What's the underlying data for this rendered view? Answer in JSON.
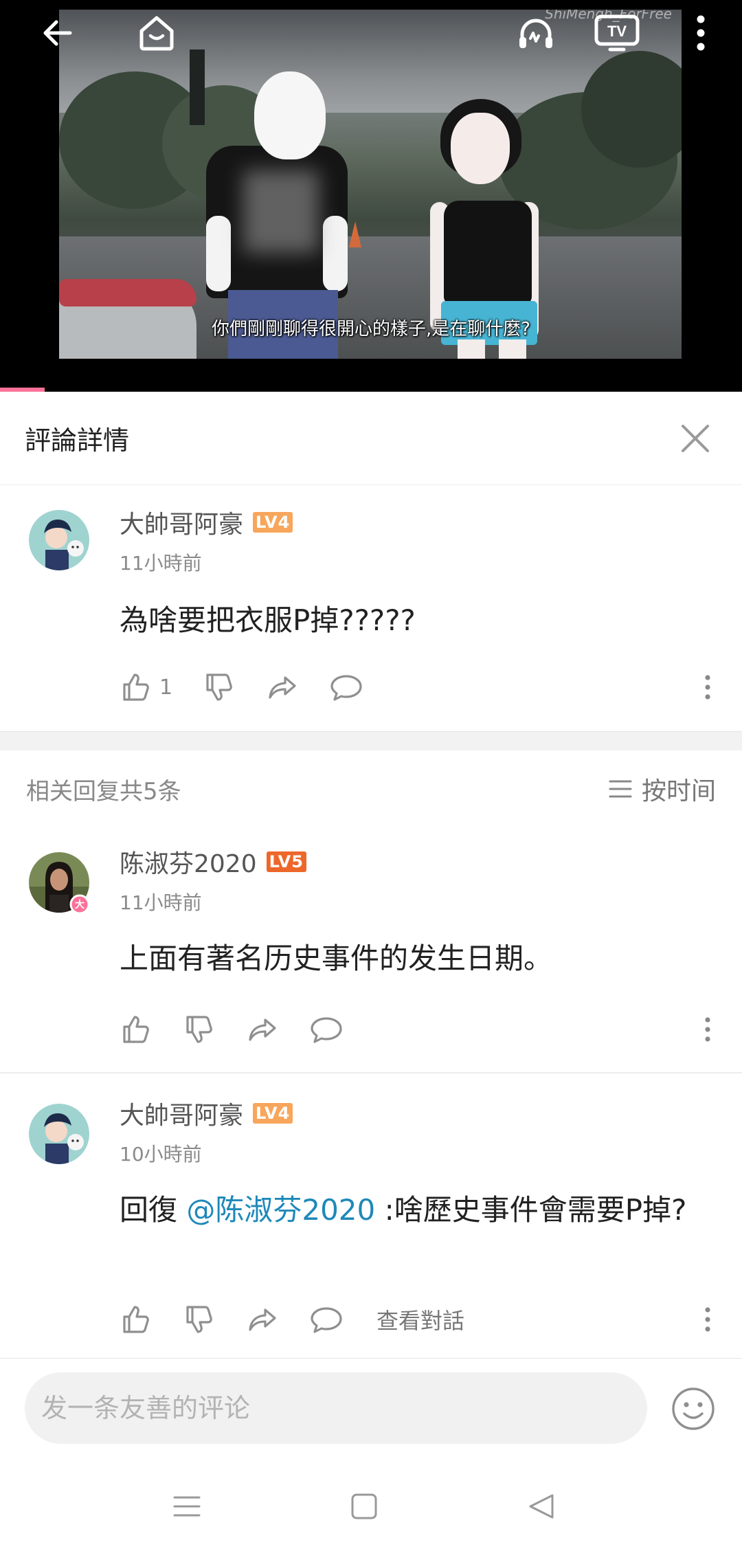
{
  "video": {
    "subtitle": "你們剛剛聊得很開心的樣子,是在聊什麼?",
    "watermark": "ShiMengh_ForFree",
    "progress_fraction": 0.06,
    "accent_color": "#fb7299",
    "icons": [
      "back-arrow-icon",
      "home-icon",
      "audio-mode-icon",
      "tv-cast-icon",
      "more-vertical-icon"
    ]
  },
  "panel": {
    "title": "評論詳情",
    "close_icon": "close-icon"
  },
  "main_comment": {
    "username": "大帥哥阿豪",
    "level": "LV4",
    "level_color": "#f7a65c",
    "time": "11小時前",
    "text": "為啥要把衣服P掉?????",
    "likes": "1"
  },
  "replies_header": {
    "count_text": "相关回复共5条",
    "sort_label": "按时间"
  },
  "replies": [
    {
      "username": "陈淑芬2020",
      "level": "LV5",
      "level_color": "#ee672a",
      "badge": "大",
      "time": "11小時前",
      "text": "上面有著名历史事件的发生日期。"
    },
    {
      "username": "大帥哥阿豪",
      "level": "LV4",
      "level_color": "#f7a65c",
      "time": "10小時前",
      "reply_prefix": "回復 ",
      "mention": "@陈淑芬2020",
      "text": " :啥歷史事件會需要P掉?",
      "view_conversation": "查看對話"
    }
  ],
  "input": {
    "placeholder": "发一条友善的评论"
  }
}
